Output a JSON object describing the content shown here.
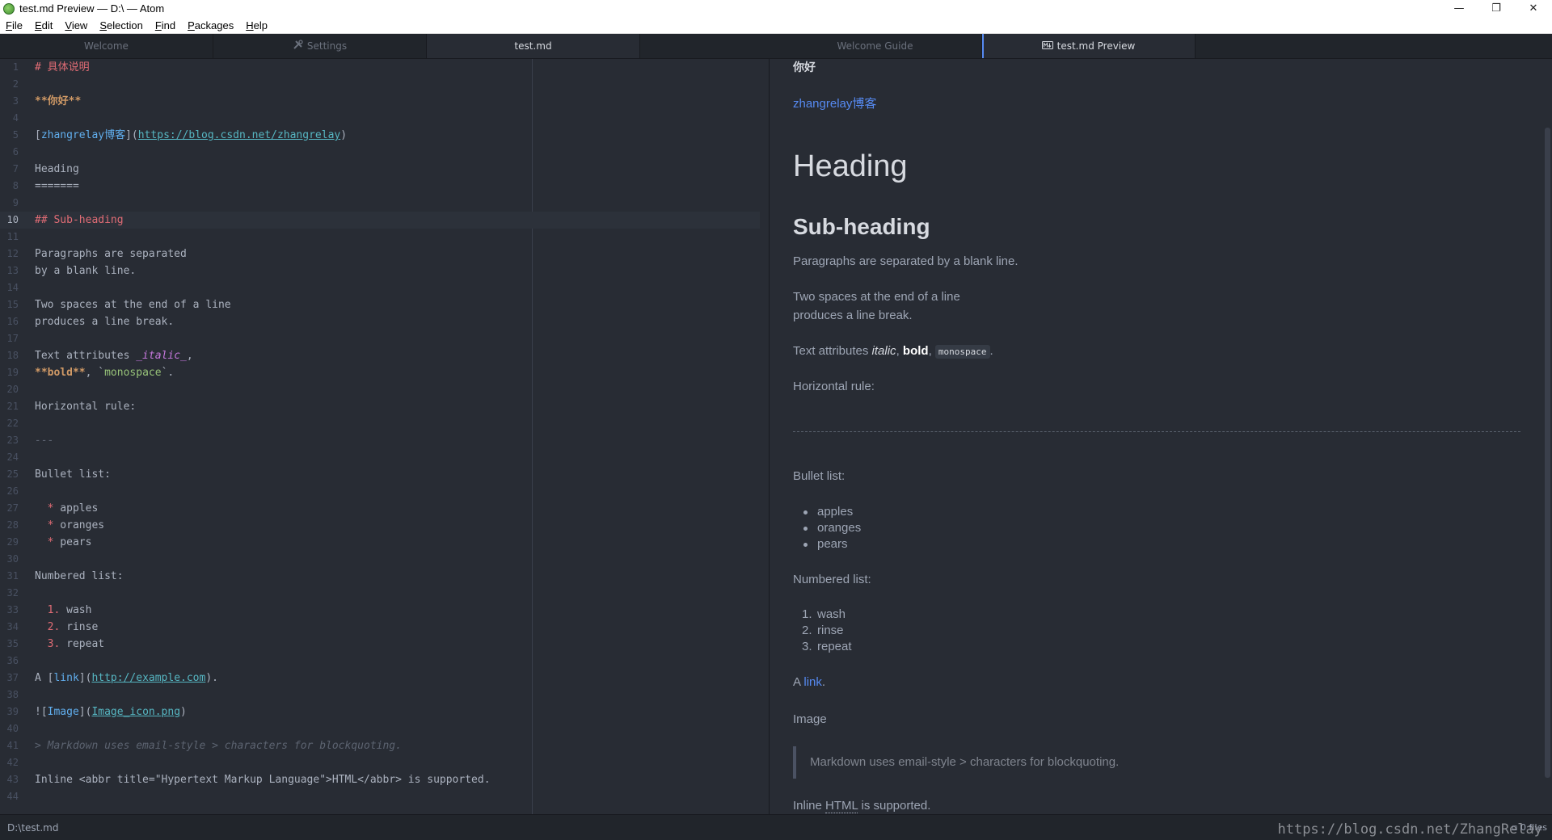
{
  "window": {
    "title": "test.md Preview — D:\\ — Atom",
    "controls": {
      "minimize": "—",
      "maximize": "❐",
      "close": "✕"
    }
  },
  "menu": [
    {
      "label": "File",
      "mnemonic": "F",
      "rest": "ile"
    },
    {
      "label": "Edit",
      "mnemonic": "E",
      "rest": "dit"
    },
    {
      "label": "View",
      "mnemonic": "V",
      "rest": "iew"
    },
    {
      "label": "Selection",
      "mnemonic": "S",
      "rest": "election"
    },
    {
      "label": "Find",
      "mnemonic": "F",
      "rest": "ind"
    },
    {
      "label": "Packages",
      "mnemonic": "P",
      "rest": "ackages"
    },
    {
      "label": "Help",
      "mnemonic": "H",
      "rest": "elp"
    }
  ],
  "left_tabs": [
    "Welcome",
    "Settings",
    "test.md"
  ],
  "right_tabs": [
    "Welcome Guide",
    "test.md Preview"
  ],
  "editor": {
    "cursor_line": 10,
    "lines": [
      "# 具体说明",
      "",
      "**你好**",
      "",
      "[zhangrelay博客](https://blog.csdn.net/zhangrelay)",
      "",
      "Heading",
      "=======",
      "",
      "## Sub-heading",
      "",
      "Paragraphs are separated",
      "by a blank line.",
      "",
      "Two spaces at the end of a line",
      "produces a line break.",
      "",
      "Text attributes _italic_,",
      "**bold**, `monospace`.",
      "",
      "Horizontal rule:",
      "",
      "---",
      "",
      "Bullet list:",
      "",
      "  * apples",
      "  * oranges",
      "  * pears",
      "",
      "Numbered list:",
      "",
      "  1. wash",
      "  2. rinse",
      "  3. repeat",
      "",
      "A [link](http://example.com).",
      "",
      "![Image](Image_icon.png)",
      "",
      "> Markdown uses email-style > characters for blockquoting.",
      "",
      "Inline <abbr title=\"Hypertext Markup Language\">HTML</abbr> is supported.",
      ""
    ]
  },
  "preview": {
    "strong": "你好",
    "blog_link": "zhangrelay博客",
    "h1": "Heading",
    "h2": "Sub-heading",
    "para1": "Paragraphs are separated by a blank line.",
    "para2_line1": "Two spaces at the end of a line",
    "para2_line2": "produces a line break.",
    "text_attr_prefix": "Text attributes ",
    "italic": "italic",
    "bold": "bold",
    "monospace": "monospace",
    "hr_label": "Horizontal rule:",
    "bullet_label": "Bullet list:",
    "bullets": [
      "apples",
      "oranges",
      "pears"
    ],
    "numbered_label": "Numbered list:",
    "numbered": [
      "wash",
      "rinse",
      "repeat"
    ],
    "link_prefix": "A ",
    "link_text": "link",
    "image_alt": "Image",
    "blockquote": "Markdown uses email-style > characters for blockquoting.",
    "inline_prefix": "Inline ",
    "abbr": "HTML",
    "inline_suffix": " is supported."
  },
  "status": {
    "path": "D:\\test.md",
    "files": "0 files",
    "watermark": "https://blog.csdn.net/ZhangRelay"
  }
}
